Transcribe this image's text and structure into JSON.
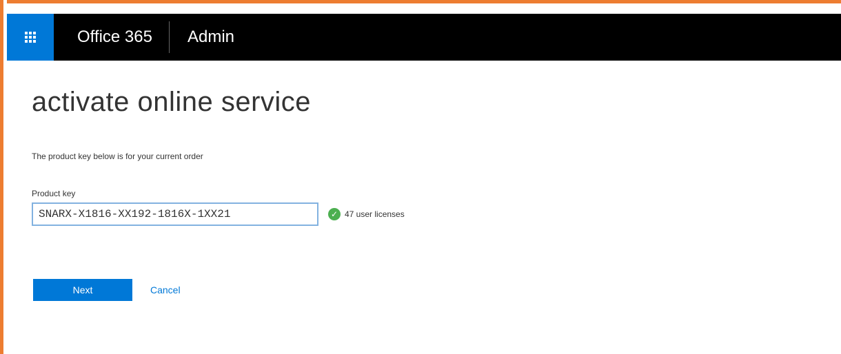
{
  "topbar": {
    "brand": "Office 365",
    "section": "Admin",
    "app_launcher_icon": "waffle-grid-icon"
  },
  "page": {
    "title": "activate online service",
    "subtitle": "The product key below is for your current order"
  },
  "product_key": {
    "label": "Product key",
    "value": "SNARX-X1816-XX192-1816X-1XX21",
    "status_icon": "check-circle-icon",
    "licenses_text": "47 user licenses"
  },
  "actions": {
    "next_label": "Next",
    "cancel_label": "Cancel"
  },
  "colors": {
    "accent": "#0078d7",
    "topbar": "#000000",
    "frame": "#ed7d31",
    "success": "#4caf50"
  }
}
